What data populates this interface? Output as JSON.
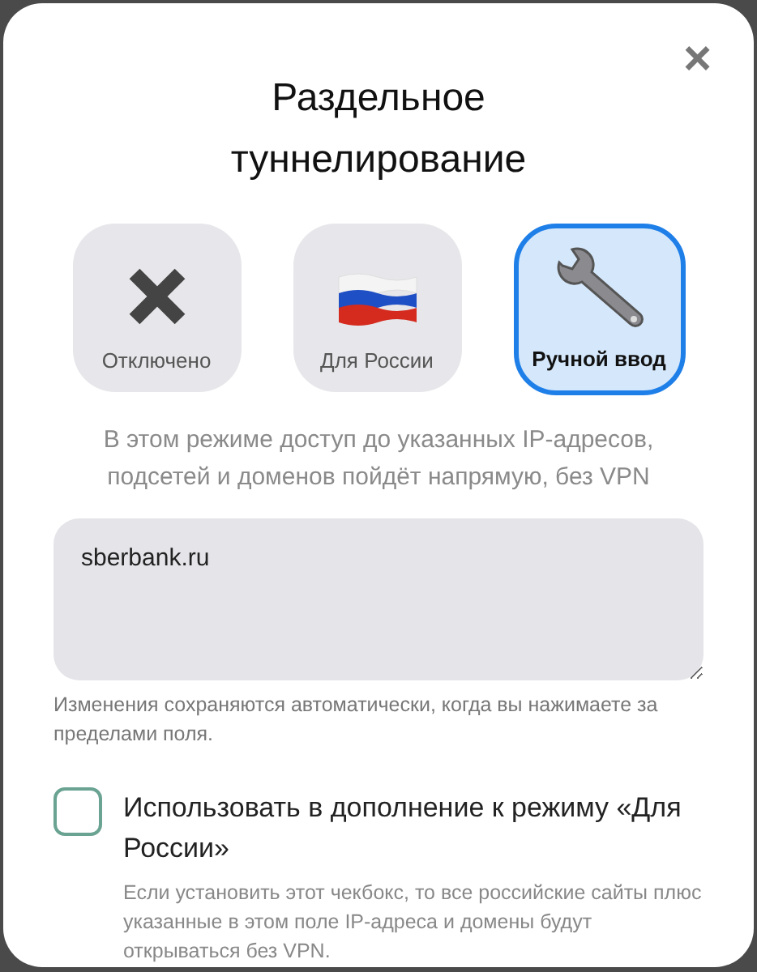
{
  "dialog": {
    "title": "Раздельное туннелирование",
    "close": "×"
  },
  "modes": [
    {
      "kind": "off",
      "label": "Отключено",
      "selected": false
    },
    {
      "kind": "russia",
      "label": "Для России",
      "selected": false
    },
    {
      "kind": "manual",
      "label": "Ручной ввод",
      "selected": true
    }
  ],
  "description": "В этом режиме доступ до указанных IP-адресов, подсетей и доменов пойдёт напрямую, без VPN",
  "domains_field": {
    "value": "sberbank.ru"
  },
  "hint": "Изменения сохраняются автоматически, когда вы нажимаете за пределами поля.",
  "combine_option": {
    "label": "Использовать в дополнение к режиму «Для России»",
    "checked": false,
    "note": "Если установить этот чекбокс, то все российские сайты плюс указанные в этом поле IP-адреса и домены будут открываться без VPN."
  }
}
